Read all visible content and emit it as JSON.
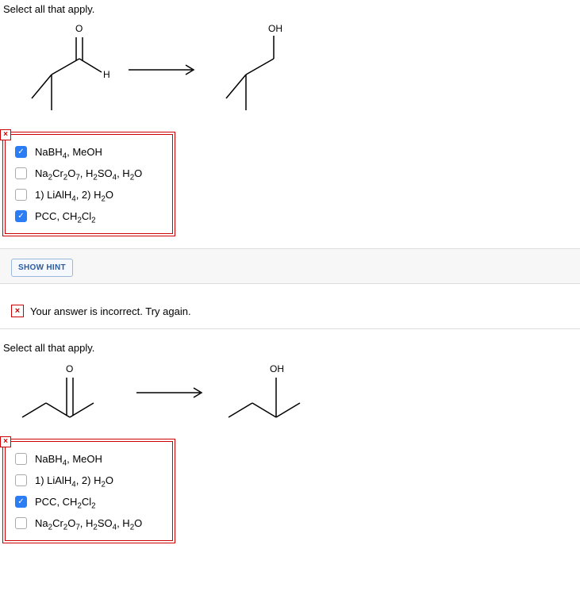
{
  "q1": {
    "prompt": "Select all that apply.",
    "reactant_labels": {
      "top": "O",
      "right": "H"
    },
    "product_labels": {
      "top": "OH"
    },
    "incorrect_marker": "×",
    "options": [
      {
        "checked": true,
        "label_html": "NaBH<sub>4</sub>, MeOH"
      },
      {
        "checked": false,
        "label_html": "Na<sub>2</sub>Cr<sub>2</sub>O<sub>7</sub>, H<sub>2</sub>SO<sub>4</sub>, H<sub>2</sub>O"
      },
      {
        "checked": false,
        "label_html": "1) LiAlH<sub>4</sub>, 2) H<sub>2</sub>O"
      },
      {
        "checked": true,
        "label_html": "PCC, CH<sub>2</sub>Cl<sub>2</sub>"
      }
    ]
  },
  "hint_button": "SHOW HINT",
  "feedback": "Your answer is incorrect.  Try again.",
  "feedback_icon": "×",
  "q2": {
    "prompt": "Select all that apply.",
    "reactant_labels": {
      "top": "O"
    },
    "product_labels": {
      "top": "OH"
    },
    "incorrect_marker": "×",
    "options": [
      {
        "checked": false,
        "label_html": "NaBH<sub>4</sub>, MeOH"
      },
      {
        "checked": false,
        "label_html": "1) LiAlH<sub>4</sub>, 2) H<sub>2</sub>O"
      },
      {
        "checked": true,
        "label_html": "PCC, CH<sub>2</sub>Cl<sub>2</sub>"
      },
      {
        "checked": false,
        "label_html": "Na<sub>2</sub>Cr<sub>2</sub>O<sub>7</sub>, H<sub>2</sub>SO<sub>4</sub>, H<sub>2</sub>O"
      }
    ]
  }
}
